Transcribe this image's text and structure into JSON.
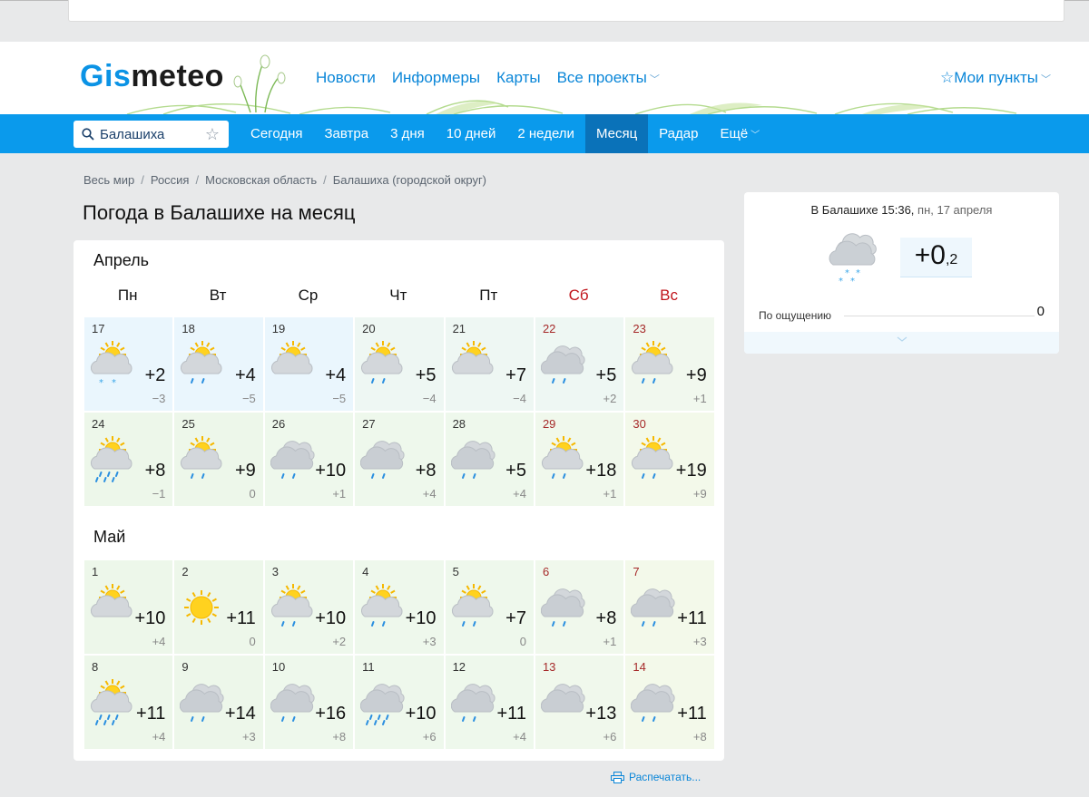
{
  "logo": {
    "part1": "Gis",
    "part2": "meteo"
  },
  "topnav": [
    {
      "label": "Новости",
      "dropdown": false
    },
    {
      "label": "Информеры",
      "dropdown": false
    },
    {
      "label": "Карты",
      "dropdown": false
    },
    {
      "label": "Все проекты",
      "dropdown": true
    }
  ],
  "my_points": {
    "label": "Мои пункты",
    "icon": "star-outline-icon"
  },
  "search": {
    "value": "Балашиха",
    "icon": "search-icon"
  },
  "tabs": [
    {
      "label": "Сегодня",
      "active": false
    },
    {
      "label": "Завтра",
      "active": false
    },
    {
      "label": "3 дня",
      "active": false
    },
    {
      "label": "10 дней",
      "active": false
    },
    {
      "label": "2 недели",
      "active": false
    },
    {
      "label": "Месяц",
      "active": true
    },
    {
      "label": "Радар",
      "active": false
    },
    {
      "label": "Ещё",
      "active": false,
      "dropdown": true
    }
  ],
  "breadcrumb": [
    "Весь мир",
    "Россия",
    "Московская область",
    "Балашиха (городской округ)"
  ],
  "page_title": "Погода в Балашихе на месяц",
  "weekdays": [
    {
      "label": "Пн",
      "weekend": false
    },
    {
      "label": "Вт",
      "weekend": false
    },
    {
      "label": "Ср",
      "weekend": false
    },
    {
      "label": "Чт",
      "weekend": false
    },
    {
      "label": "Пт",
      "weekend": false
    },
    {
      "label": "Сб",
      "weekend": true
    },
    {
      "label": "Вс",
      "weekend": true
    }
  ],
  "months": [
    {
      "name": "Апрель",
      "days": [
        {
          "day": "17",
          "icon": "partly-cloudy-snow",
          "tmax": "+2",
          "tmin": "−3"
        },
        {
          "day": "18",
          "icon": "partly-cloudy-rain",
          "tmax": "+4",
          "tmin": "−5"
        },
        {
          "day": "19",
          "icon": "partly-cloudy",
          "tmax": "+4",
          "tmin": "−5"
        },
        {
          "day": "20",
          "icon": "partly-cloudy-rain",
          "tmax": "+5",
          "tmin": "−4"
        },
        {
          "day": "21",
          "icon": "partly-cloudy",
          "tmax": "+7",
          "tmin": "−4"
        },
        {
          "day": "22",
          "icon": "cloudy-rain",
          "tmax": "+5",
          "tmin": "+2"
        },
        {
          "day": "23",
          "icon": "partly-cloudy-rain",
          "tmax": "+9",
          "tmin": "+1"
        },
        {
          "day": "24",
          "icon": "partly-cloudy-heavy-rain",
          "tmax": "+8",
          "tmin": "−1"
        },
        {
          "day": "25",
          "icon": "partly-cloudy-rain",
          "tmax": "+9",
          "tmin": "0"
        },
        {
          "day": "26",
          "icon": "cloudy-rain",
          "tmax": "+10",
          "tmin": "+1"
        },
        {
          "day": "27",
          "icon": "cloudy-rain",
          "tmax": "+8",
          "tmin": "+4"
        },
        {
          "day": "28",
          "icon": "cloudy-rain",
          "tmax": "+5",
          "tmin": "+4"
        },
        {
          "day": "29",
          "icon": "partly-cloudy-rain",
          "tmax": "+18",
          "tmin": "+1"
        },
        {
          "day": "30",
          "icon": "partly-cloudy-rain",
          "tmax": "+19",
          "tmin": "+9"
        }
      ]
    },
    {
      "name": "Май",
      "days": [
        {
          "day": "1",
          "icon": "partly-cloudy",
          "tmax": "+10",
          "tmin": "+4"
        },
        {
          "day": "2",
          "icon": "sunny",
          "tmax": "+11",
          "tmin": "0"
        },
        {
          "day": "3",
          "icon": "partly-cloudy-rain",
          "tmax": "+10",
          "tmin": "+2"
        },
        {
          "day": "4",
          "icon": "partly-cloudy-rain",
          "tmax": "+10",
          "tmin": "+3"
        },
        {
          "day": "5",
          "icon": "partly-cloudy-rain",
          "tmax": "+7",
          "tmin": "0"
        },
        {
          "day": "6",
          "icon": "cloudy-rain",
          "tmax": "+8",
          "tmin": "+1"
        },
        {
          "day": "7",
          "icon": "cloudy-rain",
          "tmax": "+11",
          "tmin": "+3"
        },
        {
          "day": "8",
          "icon": "partly-cloudy-heavy-rain",
          "tmax": "+11",
          "tmin": "+4"
        },
        {
          "day": "9",
          "icon": "cloudy-rain",
          "tmax": "+14",
          "tmin": "+3"
        },
        {
          "day": "10",
          "icon": "cloudy-rain",
          "tmax": "+16",
          "tmin": "+8"
        },
        {
          "day": "11",
          "icon": "cloudy-heavy-rain",
          "tmax": "+10",
          "tmin": "+6"
        },
        {
          "day": "12",
          "icon": "cloudy-rain",
          "tmax": "+11",
          "tmin": "+4"
        },
        {
          "day": "13",
          "icon": "cloudy",
          "tmax": "+13",
          "tmin": "+6"
        },
        {
          "day": "14",
          "icon": "cloudy-rain",
          "tmax": "+11",
          "tmin": "+8"
        }
      ]
    }
  ],
  "current": {
    "place_time": "В Балашихе 15:36,",
    "date": "пн, 17 апреля",
    "icon": "cloudy-snow",
    "temp_int": "+0",
    "temp_frac": ",2",
    "feels_label": "По ощущению",
    "feels_value": "0"
  },
  "print_label": "Распечатать...",
  "colors": {
    "brand_blue": "#0a9aec",
    "active_tab": "#0a72b9",
    "link": "#0a86d8",
    "weekend": "#c0141b"
  }
}
